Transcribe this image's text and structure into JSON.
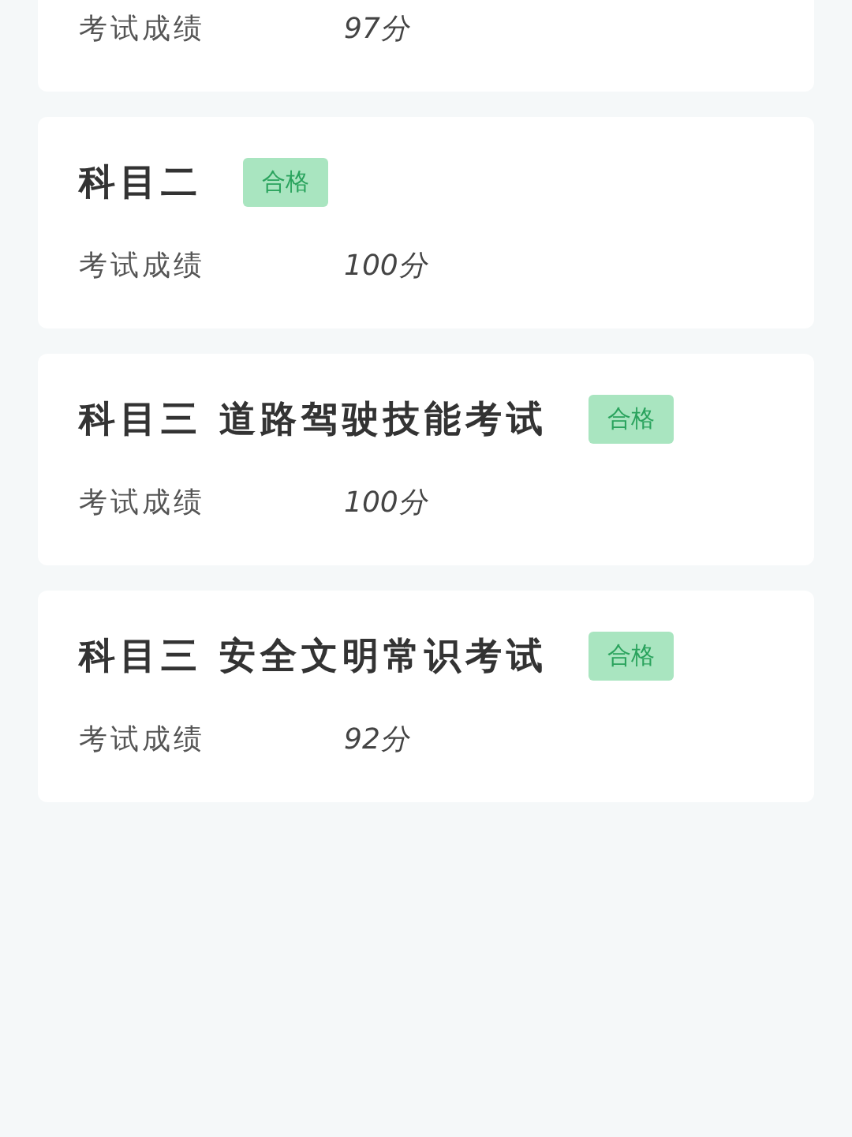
{
  "results": [
    {
      "score_label": "考试成绩",
      "score": "97分"
    },
    {
      "title": "科目二",
      "status": "合格",
      "passed": true,
      "score_label": "考试成绩",
      "score": "100分"
    },
    {
      "title": "科目三 道路驾驶技能考试",
      "status": "合格",
      "passed": true,
      "score_label": "考试成绩",
      "score": "100分"
    },
    {
      "title": "科目三 安全文明常识考试",
      "status": "合格",
      "passed": true,
      "score_label": "考试成绩",
      "score": "92分"
    }
  ]
}
